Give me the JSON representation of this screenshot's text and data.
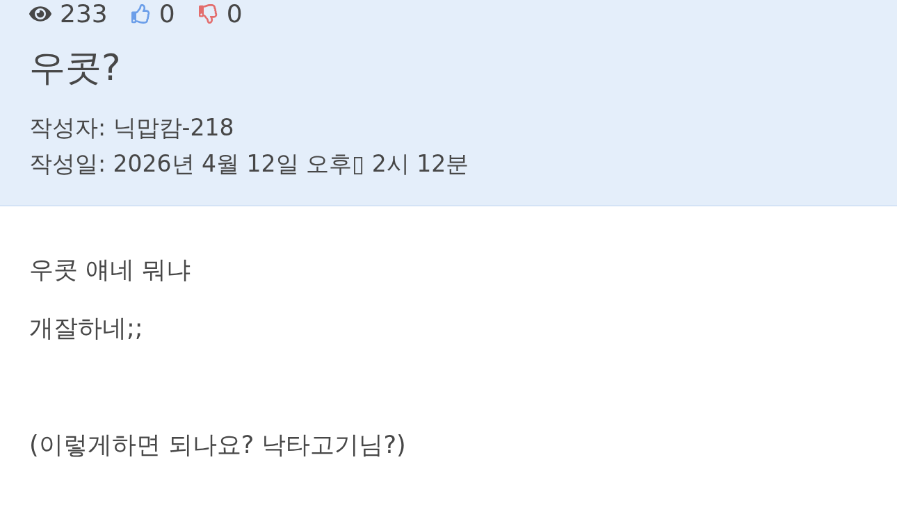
{
  "stats": {
    "views": "233",
    "likes": "0",
    "dislikes": "0"
  },
  "post": {
    "title": "우콧?",
    "author": "작성자: 닉맙캄-218",
    "date": "작성일: 2026년 4월 12일 오후▯ 2시 12분"
  },
  "body": [
    {
      "kind": "text",
      "text": "우콧 얘네 뭐냐"
    },
    {
      "kind": "text",
      "text": "개잘하네;;"
    },
    {
      "kind": "break"
    },
    {
      "kind": "text",
      "text": "(이렇게하면 되나요? 낙타고기님?)"
    }
  ]
}
